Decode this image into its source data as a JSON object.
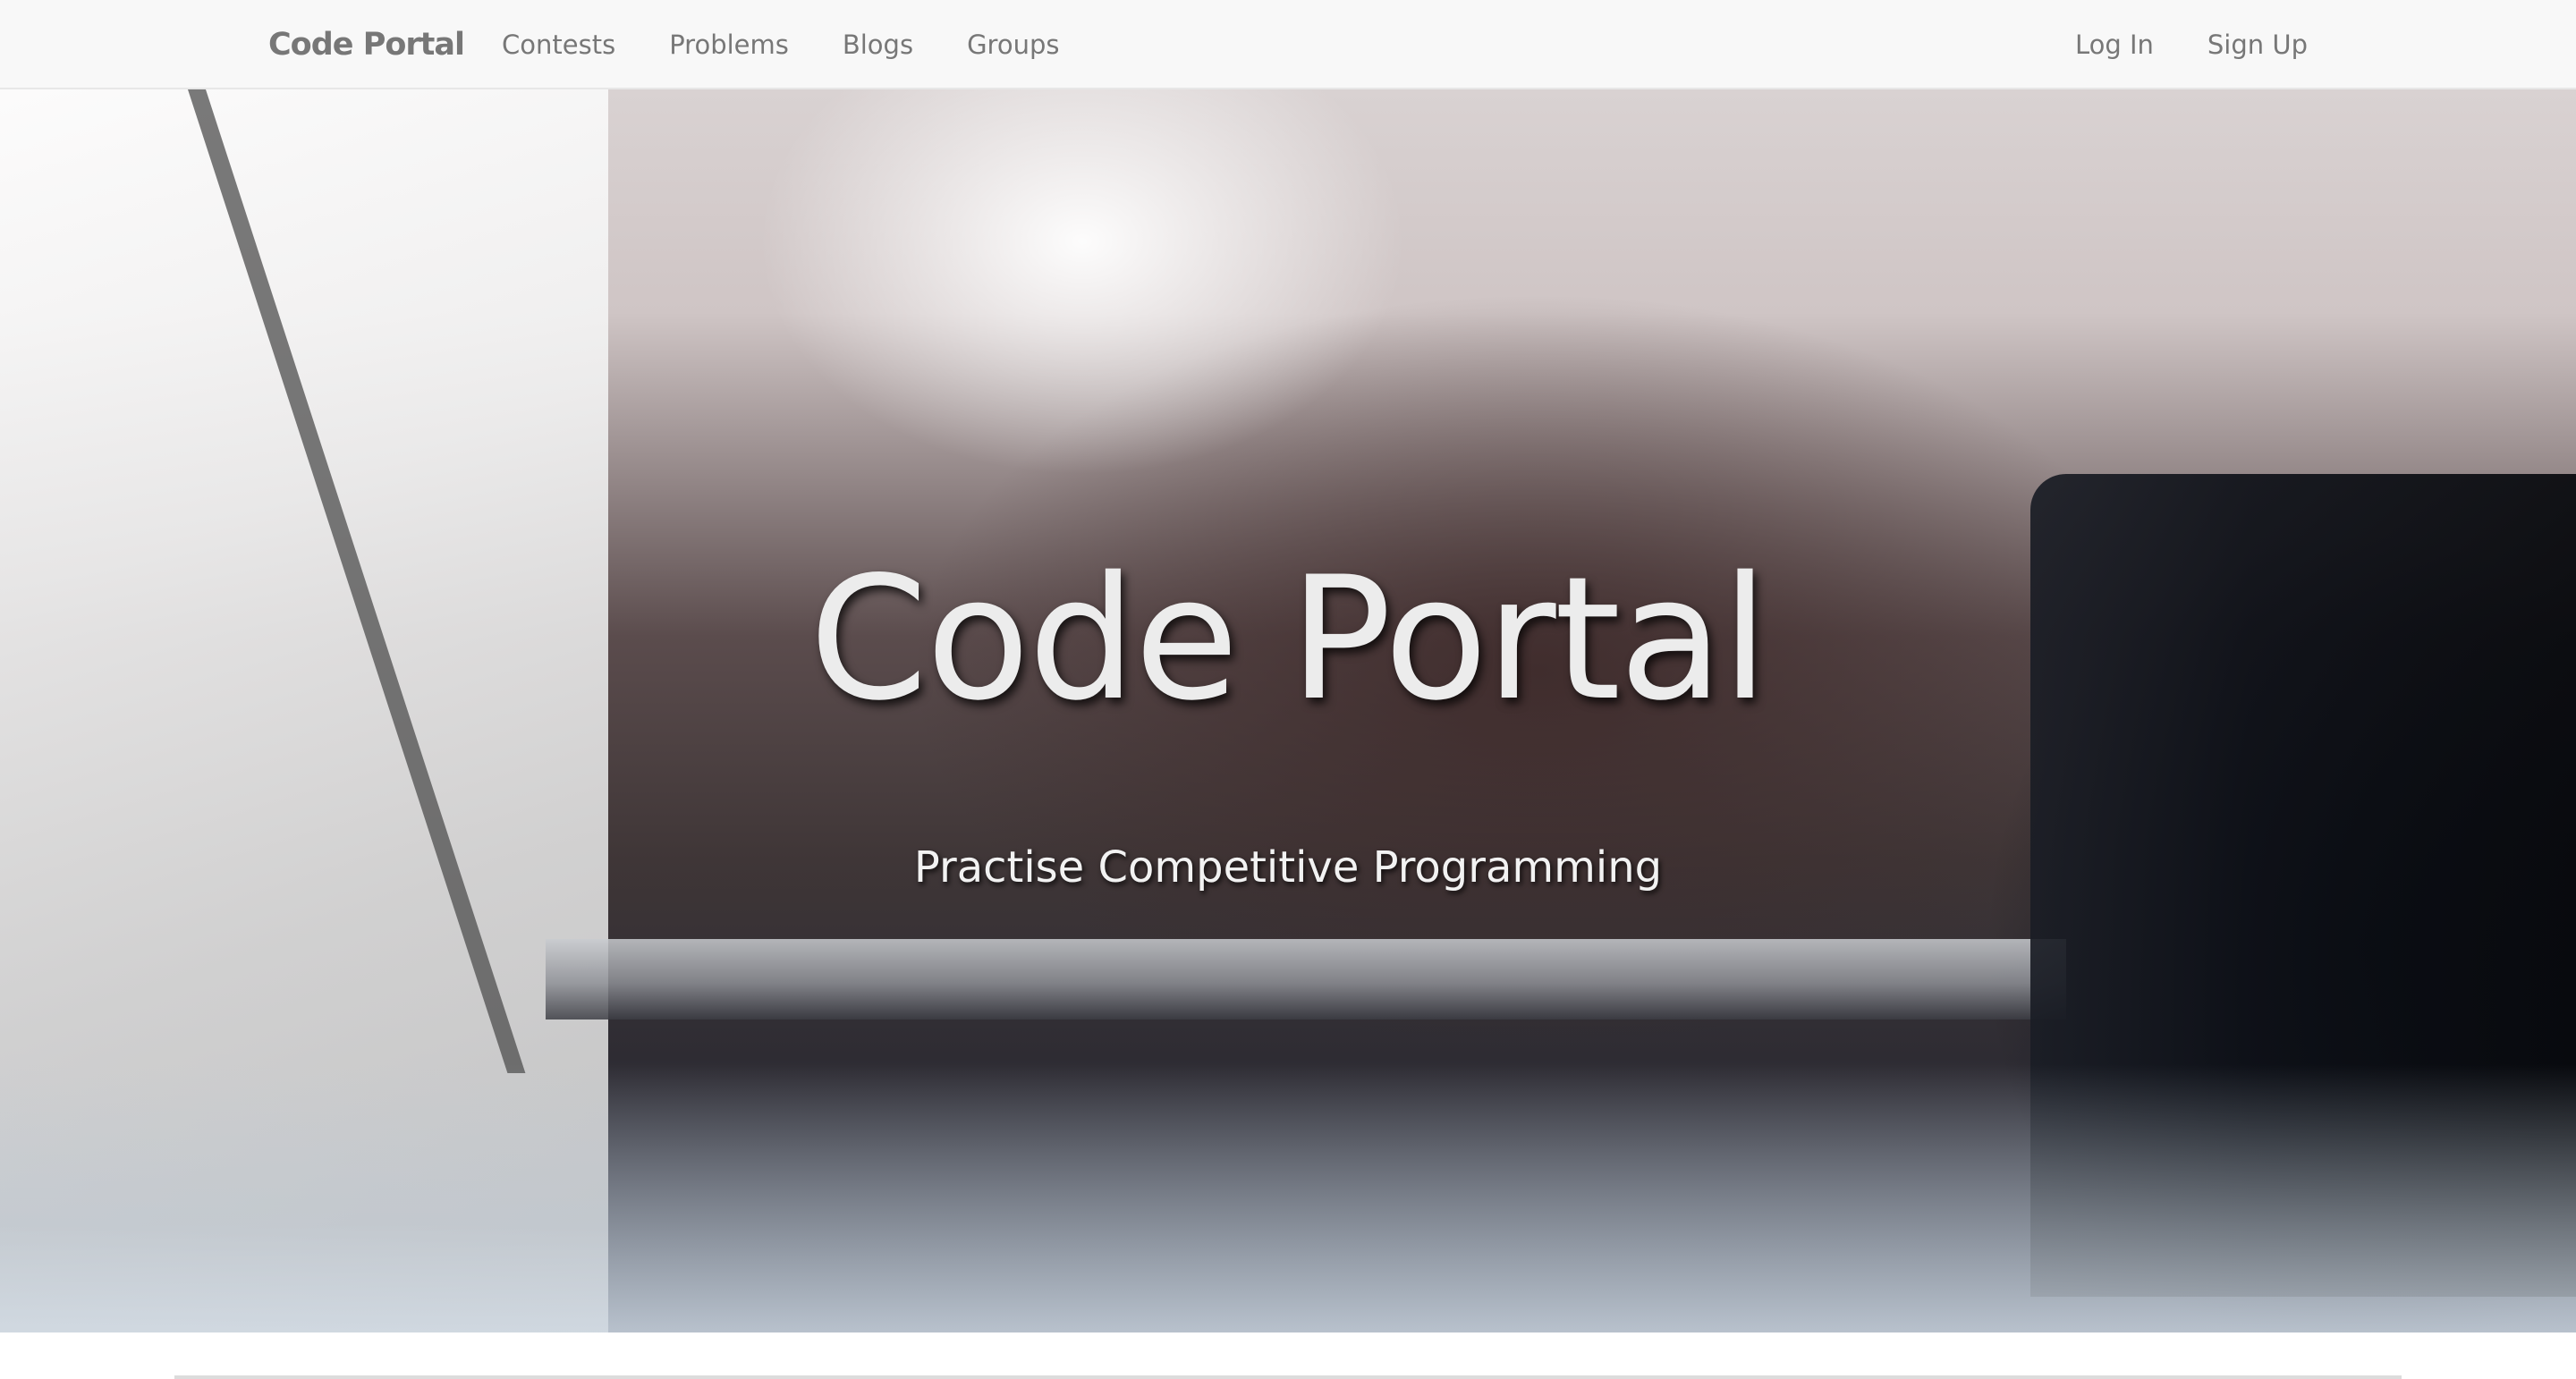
{
  "navbar": {
    "brand": "Code Portal",
    "links": [
      {
        "label": "Contests"
      },
      {
        "label": "Problems"
      },
      {
        "label": "Blogs"
      },
      {
        "label": "Groups"
      }
    ],
    "auth": [
      {
        "label": "Log In"
      },
      {
        "label": "Sign Up"
      }
    ]
  },
  "hero": {
    "title": "Code Portal",
    "subtitle": "Practise Competitive Programming"
  },
  "colors": {
    "navbar_bg": "#f8f8f8",
    "nav_text": "#777777",
    "hero_text": "#ececec"
  }
}
